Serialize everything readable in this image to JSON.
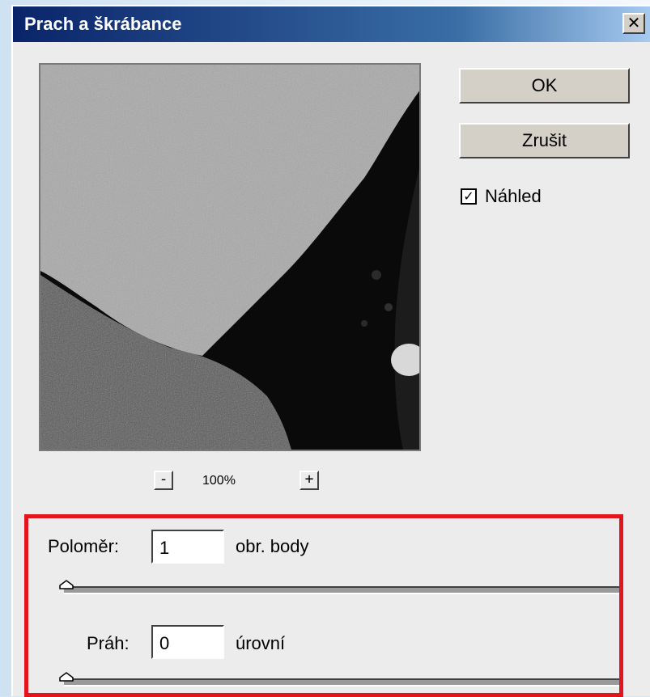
{
  "dialog": {
    "title": "Prach a škrábance",
    "close_label": "✕"
  },
  "buttons": {
    "ok_label": "OK",
    "cancel_label": "Zrušit"
  },
  "preview_checkbox": {
    "label": "Náhled",
    "checked": true,
    "check_glyph": "✓"
  },
  "zoom": {
    "minus_label": "-",
    "level": "100%",
    "plus_label": "+"
  },
  "radius": {
    "label": "Poloměr:",
    "value": "1",
    "unit": "obr. body",
    "slider_level": 0.0
  },
  "threshold": {
    "label": "Práh:",
    "value": "0",
    "unit": "úrovní",
    "slider_level": 0.0
  },
  "accent_colors": {
    "title_bar_start": "#0a246a",
    "highlight_box": "#e3141e"
  }
}
